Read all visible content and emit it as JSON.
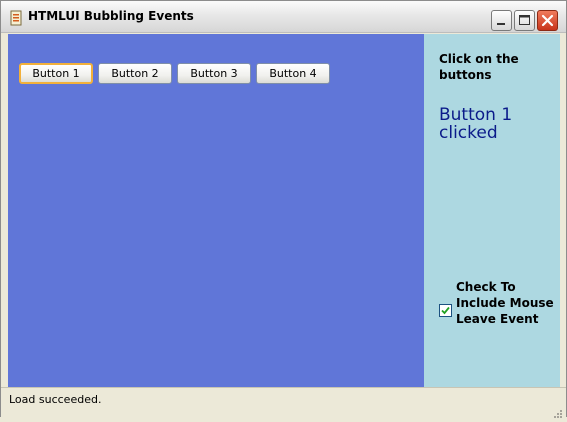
{
  "window": {
    "title": "HTMLUI Bubbling Events"
  },
  "buttons": [
    {
      "label": "Button 1",
      "focused": true
    },
    {
      "label": "Button 2",
      "focused": false
    },
    {
      "label": "Button 3",
      "focused": false
    },
    {
      "label": "Button 4",
      "focused": false
    }
  ],
  "right_panel": {
    "instruction": "Click on the buttons",
    "status_message": "Button 1 clicked",
    "checkbox": {
      "label": "Check To Include Mouse Leave Event",
      "checked": true
    }
  },
  "statusbar": {
    "text": "Load succeeded."
  },
  "colors": {
    "left_pane": "#6076d8",
    "right_pane": "#add8e1",
    "status_message": "#0b1b8a",
    "focus_ring": "#f2b03b"
  },
  "icons": [
    "app-icon",
    "minimize-icon",
    "maximize-icon",
    "close-icon",
    "checkmark-icon",
    "resize-grip-icon"
  ]
}
